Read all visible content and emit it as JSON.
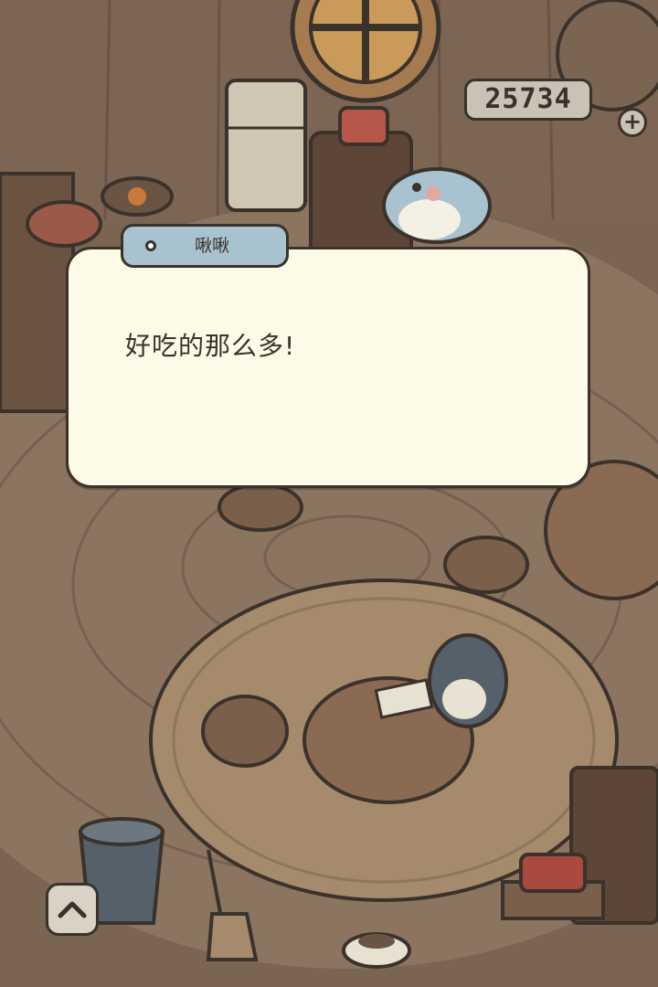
{
  "hud": {
    "currency_value": "25734",
    "currency_plus_label": "+"
  },
  "dialog": {
    "speaker_name": "啾啾",
    "message": "好吃的那么多!"
  },
  "controls": {
    "expand_icon": "chevron-up-icon"
  },
  "colors": {
    "dialog_bg": "#fdfbe7",
    "nameplate_bg": "#a8c3cf",
    "outline": "#3a322b",
    "floor": "#7a6452"
  }
}
